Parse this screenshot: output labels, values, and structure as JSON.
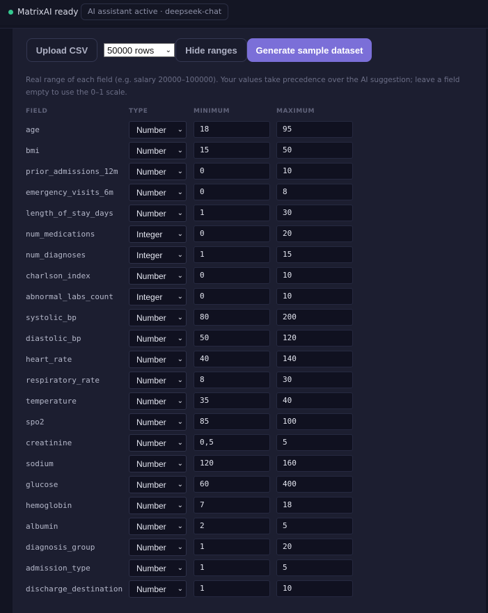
{
  "topbar": {
    "status": "MatrixAI ready",
    "assistant": "AI assistant active · deepseek-chat"
  },
  "toolbar": {
    "upload": "Upload CSV",
    "rows_selected": "50000 rows",
    "hide_ranges": "Hide ranges",
    "generate": "Generate sample dataset"
  },
  "help_text": "Real range of each field (e.g. salary 20000–100000). Your values take precedence over the AI suggestion; leave a field empty to use the 0–1 scale.",
  "columns": {
    "field": "FIELD",
    "type": "TYPE",
    "minimum": "MINIMUM",
    "maximum": "MAXIMUM"
  },
  "fields": [
    {
      "name": "age",
      "type": "Number",
      "min": "18",
      "max": "95"
    },
    {
      "name": "bmi",
      "type": "Number",
      "min": "15",
      "max": "50"
    },
    {
      "name": "prior_admissions_12m",
      "type": "Number",
      "min": "0",
      "max": "10"
    },
    {
      "name": "emergency_visits_6m",
      "type": "Number",
      "min": "0",
      "max": "8"
    },
    {
      "name": "length_of_stay_days",
      "type": "Number",
      "min": "1",
      "max": "30"
    },
    {
      "name": "num_medications",
      "type": "Integer",
      "min": "0",
      "max": "20"
    },
    {
      "name": "num_diagnoses",
      "type": "Integer",
      "min": "1",
      "max": "15"
    },
    {
      "name": "charlson_index",
      "type": "Number",
      "min": "0",
      "max": "10"
    },
    {
      "name": "abnormal_labs_count",
      "type": "Integer",
      "min": "0",
      "max": "10"
    },
    {
      "name": "systolic_bp",
      "type": "Number",
      "min": "80",
      "max": "200"
    },
    {
      "name": "diastolic_bp",
      "type": "Number",
      "min": "50",
      "max": "120"
    },
    {
      "name": "heart_rate",
      "type": "Number",
      "min": "40",
      "max": "140"
    },
    {
      "name": "respiratory_rate",
      "type": "Number",
      "min": "8",
      "max": "30"
    },
    {
      "name": "temperature",
      "type": "Number",
      "min": "35",
      "max": "40"
    },
    {
      "name": "spo2",
      "type": "Number",
      "min": "85",
      "max": "100"
    },
    {
      "name": "creatinine",
      "type": "Number",
      "min": "0,5",
      "max": "5"
    },
    {
      "name": "sodium",
      "type": "Number",
      "min": "120",
      "max": "160"
    },
    {
      "name": "glucose",
      "type": "Number",
      "min": "60",
      "max": "400"
    },
    {
      "name": "hemoglobin",
      "type": "Number",
      "min": "7",
      "max": "18"
    },
    {
      "name": "albumin",
      "type": "Number",
      "min": "2",
      "max": "5"
    },
    {
      "name": "diagnosis_group",
      "type": "Number",
      "min": "1",
      "max": "20"
    },
    {
      "name": "admission_type",
      "type": "Number",
      "min": "1",
      "max": "5"
    },
    {
      "name": "discharge_destination",
      "type": "Number",
      "min": "1",
      "max": "10"
    }
  ],
  "colors": {
    "accent": "#7b6fd8",
    "status_dot": "#34c990",
    "background": "#121422",
    "panel": "#1c1e30"
  },
  "icons": {
    "status": "status-dot-icon",
    "select": "chevron-down-icon"
  }
}
